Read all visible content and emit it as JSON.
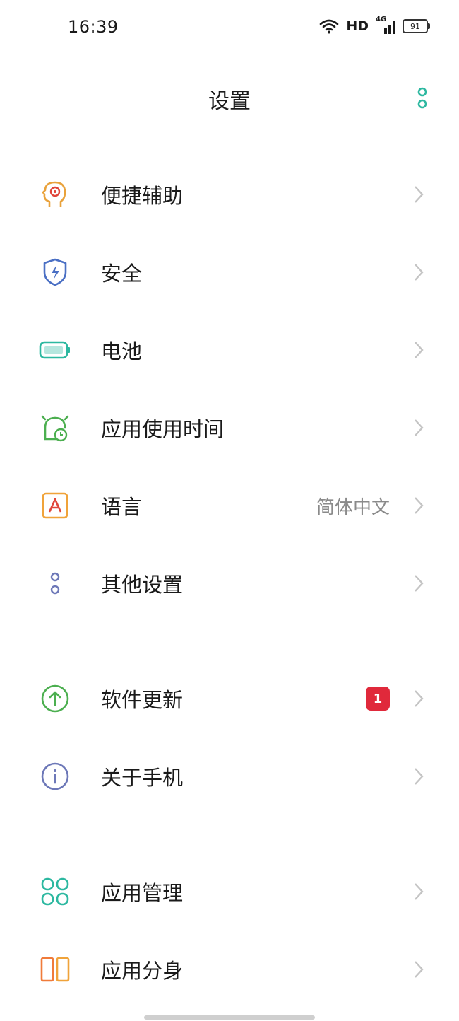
{
  "status_bar": {
    "time": "16:39",
    "network_label": "HD",
    "signal_label": "4G",
    "battery_level": "91"
  },
  "header": {
    "title": "设置"
  },
  "sections": [
    {
      "items": [
        {
          "id": "accessibility",
          "label": "便捷辅助",
          "icon": "accessibility-head-icon",
          "color": "#e9a23b"
        },
        {
          "id": "security",
          "label": "安全",
          "icon": "shield-bolt-icon",
          "color": "#4a6fc4"
        },
        {
          "id": "battery",
          "label": "电池",
          "icon": "battery-icon",
          "color": "#2cb8a0"
        },
        {
          "id": "screen-time",
          "label": "应用使用时间",
          "icon": "alarm-clock-icon",
          "color": "#4caf50"
        },
        {
          "id": "language",
          "label": "语言",
          "value": "简体中文",
          "icon": "letter-a-icon",
          "color": "#f0a33a"
        },
        {
          "id": "other-settings",
          "label": "其他设置",
          "icon": "two-dots-icon",
          "color": "#6d78b8"
        }
      ]
    },
    {
      "items": [
        {
          "id": "software-update",
          "label": "软件更新",
          "badge": "1",
          "icon": "arrow-up-circle-icon",
          "color": "#4caf50"
        },
        {
          "id": "about-phone",
          "label": "关于手机",
          "icon": "info-circle-icon",
          "color": "#6d78b8"
        }
      ]
    },
    {
      "items": [
        {
          "id": "app-management",
          "label": "应用管理",
          "icon": "four-squares-icon",
          "color": "#2cb8a0"
        },
        {
          "id": "app-clone",
          "label": "应用分身",
          "icon": "dual-rectangles-icon",
          "color": "#f07b3a"
        }
      ]
    }
  ],
  "colors": {
    "accent": "#2cb8a0",
    "badge": "#e0293b",
    "chevron": "#c4c4c4"
  }
}
